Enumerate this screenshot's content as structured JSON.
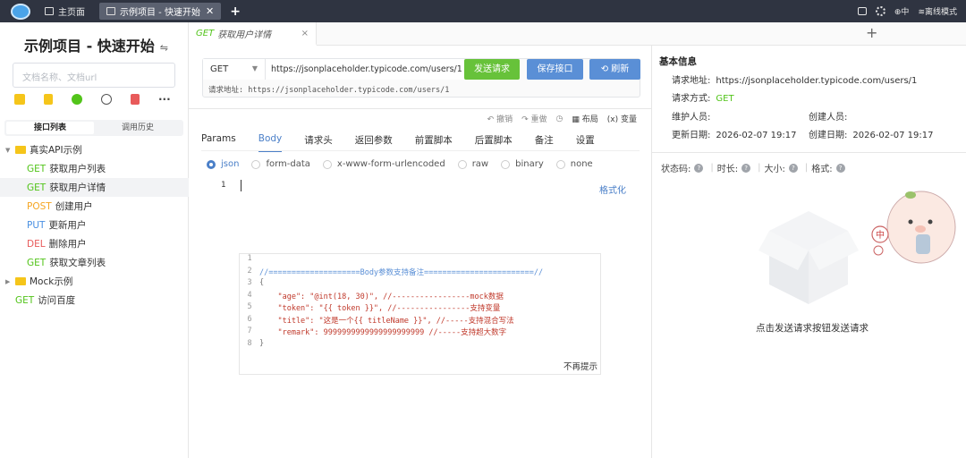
{
  "titlebar": {
    "tabs": [
      {
        "label": "主页面",
        "active": false
      },
      {
        "label": "示例项目 - 快速开始",
        "active": true
      }
    ],
    "offline_label": "离线模式",
    "lang_label": "中"
  },
  "sidebar": {
    "project_title": "示例项目 - 快速开始",
    "switch_icon": "⇋",
    "search_placeholder": "文档名称、文档url",
    "segment": {
      "interfaces": "接口列表",
      "history": "调用历史"
    },
    "tree": [
      {
        "type": "folder",
        "label": "真实API示例",
        "expanded": true
      },
      {
        "type": "api",
        "method": "GET",
        "label": "获取用户列表"
      },
      {
        "type": "api",
        "method": "GET",
        "label": "获取用户详情",
        "selected": true
      },
      {
        "type": "api",
        "method": "POST",
        "label": "创建用户"
      },
      {
        "type": "api",
        "method": "PUT",
        "label": "更新用户"
      },
      {
        "type": "api",
        "method": "DEL",
        "label": "删除用户"
      },
      {
        "type": "api",
        "method": "GET",
        "label": "获取文章列表"
      },
      {
        "type": "folder",
        "label": "Mock示例",
        "expanded": false
      },
      {
        "type": "api",
        "method": "GET",
        "label": "访问百度",
        "root": true
      }
    ]
  },
  "editor_tab": {
    "method": "GET",
    "title": "获取用户详情",
    "close": "×"
  },
  "request": {
    "method": "GET",
    "url": "https://jsonplaceholder.typicode.com/users/1",
    "send": "发送请求",
    "save": "保存接口",
    "refresh": "刷新",
    "address_line": "请求地址: https://jsonplaceholder.typicode.com/users/1"
  },
  "toolbar": {
    "undo": "撤销",
    "redo": "重做",
    "layout": "布局",
    "variables": "变量"
  },
  "tabs": [
    "Params",
    "Body",
    "请求头",
    "返回参数",
    "前置脚本",
    "后置脚本",
    "备注",
    "设置"
  ],
  "active_tab": "Body",
  "body_types": [
    "json",
    "form-data",
    "x-www-form-urlencoded",
    "raw",
    "binary",
    "none"
  ],
  "active_body_type": "json",
  "editor": {
    "line": "1",
    "format": "格式化"
  },
  "hint": {
    "lines": [
      "",
      "//====================Body参数支持备注========================//",
      "{",
      "    \"age\": \"@int(18, 30)\", //-----------------mock数据",
      "    \"token\": \"{{ token }}\", //----------------支持变量",
      "    \"title\": \"这是一个{{ titleName }}\", //-----支持混合写法",
      "    \"remark\": 9999999999999999999999 //-----支持超大数字",
      "}"
    ],
    "dismiss": "不再提示"
  },
  "info": {
    "title": "基本信息",
    "url_label": "请求地址:",
    "url": "https://jsonplaceholder.typicode.com/users/1",
    "method_label": "请求方式:",
    "method": "GET",
    "maintainer_label": "维护人员:",
    "creator_label": "创建人员:",
    "updated_label": "更新日期:",
    "updated": "2026-02-07 19:17",
    "created_label": "创建日期:",
    "created": "2026-02-07 19:17"
  },
  "response": {
    "status_label": "状态码:",
    "time_label": "时长:",
    "size_label": "大小:",
    "format_label": "格式:",
    "q": "?",
    "empty_text": "点击发送请求按钮发送请求",
    "mascot_text": "中"
  },
  "colors": {
    "get": "#52c41a",
    "post": "#f5a623",
    "put": "#4a90e2",
    "del": "#e85a5a",
    "accent": "#4a7fc8"
  }
}
